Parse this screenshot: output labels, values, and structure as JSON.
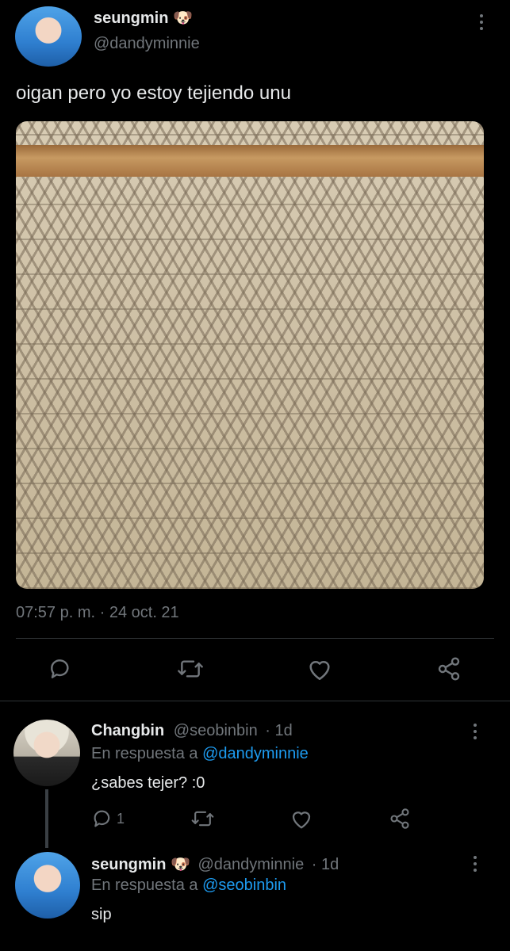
{
  "tweet": {
    "display_name": "seungmin",
    "emoji": "🐶",
    "handle": "@dandyminnie",
    "text": "oigan pero yo estoy tejiendo unu",
    "image_alt": "",
    "timestamp": "07:57 p. m. · 24 oct. 21"
  },
  "actions": {
    "reply_icon": "reply-icon",
    "retweet_icon": "retweet-icon",
    "like_icon": "heart-icon",
    "share_icon": "share-icon"
  },
  "replies": [
    {
      "display_name": "Changbin",
      "handle": "@seobinbin",
      "time": "· 1d",
      "reply_prefix": "En respuesta a",
      "reply_to": "@dandyminnie",
      "text": "¿sabes tejer? :0",
      "reply_count": "1"
    },
    {
      "display_name": "seungmin",
      "emoji": "🐶",
      "handle": "@dandyminnie",
      "time": "· 1d",
      "reply_prefix": "En respuesta a",
      "reply_to": "@seobinbin",
      "text": "sip"
    }
  ],
  "colors": {
    "background": "#000000",
    "text": "#e7e9ea",
    "muted": "#71767b",
    "link": "#1d9bf0",
    "divider": "#2f3336"
  }
}
